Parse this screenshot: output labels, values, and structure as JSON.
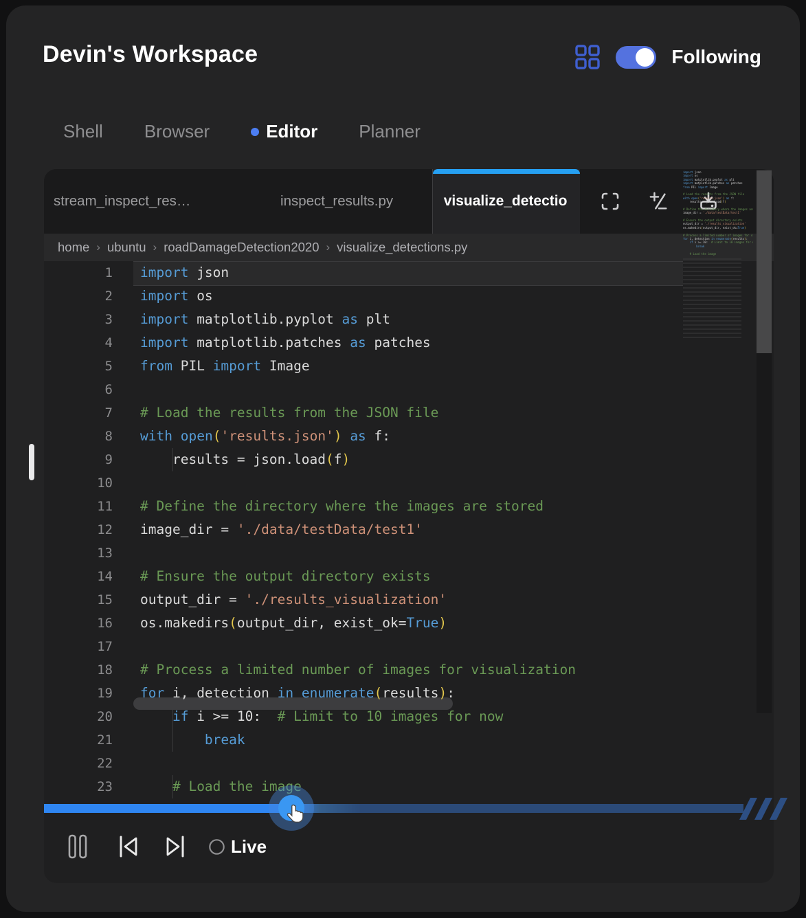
{
  "header": {
    "title": "Devin's Workspace",
    "toggle_label": "Following",
    "toggle_on": true
  },
  "nav_tabs": [
    {
      "label": "Shell",
      "active": false
    },
    {
      "label": "Browser",
      "active": false
    },
    {
      "label": "Editor",
      "active": true
    },
    {
      "label": "Planner",
      "active": false
    }
  ],
  "editor": {
    "file_tabs": [
      {
        "label": "stream_inspect_res…",
        "active": false
      },
      {
        "label": "inspect_results.py",
        "active": false
      },
      {
        "label": "visualize_detectio",
        "active": true
      }
    ],
    "breadcrumb": [
      "home",
      "ubuntu",
      "roadDamageDetection2020",
      "visualize_detections.py"
    ],
    "code_lines": [
      {
        "n": 1,
        "hl": true,
        "t": [
          [
            "k",
            "import"
          ],
          [
            "p",
            " json"
          ]
        ]
      },
      {
        "n": 2,
        "t": [
          [
            "k",
            "import"
          ],
          [
            "p",
            " os"
          ]
        ]
      },
      {
        "n": 3,
        "t": [
          [
            "k",
            "import"
          ],
          [
            "p",
            " matplotlib.pyplot "
          ],
          [
            "k",
            "as"
          ],
          [
            "p",
            " plt"
          ]
        ]
      },
      {
        "n": 4,
        "t": [
          [
            "k",
            "import"
          ],
          [
            "p",
            " matplotlib.patches "
          ],
          [
            "k",
            "as"
          ],
          [
            "p",
            " patches"
          ]
        ]
      },
      {
        "n": 5,
        "t": [
          [
            "k",
            "from"
          ],
          [
            "p",
            " PIL "
          ],
          [
            "k",
            "import"
          ],
          [
            "p",
            " Image"
          ]
        ]
      },
      {
        "n": 6,
        "t": []
      },
      {
        "n": 7,
        "t": [
          [
            "c",
            "# Load the results from the JSON file"
          ]
        ]
      },
      {
        "n": 8,
        "t": [
          [
            "k",
            "with"
          ],
          [
            "p",
            " "
          ],
          [
            "k",
            "open"
          ],
          [
            "y",
            "("
          ],
          [
            "s",
            "'results.json'"
          ],
          [
            "y",
            ")"
          ],
          [
            "p",
            " "
          ],
          [
            "k",
            "as"
          ],
          [
            "p",
            " f:"
          ]
        ]
      },
      {
        "n": 9,
        "g": [
          1
        ],
        "t": [
          [
            "p",
            "    results = json.load"
          ],
          [
            "y",
            "("
          ],
          [
            "p",
            "f"
          ],
          [
            "y",
            ")"
          ]
        ]
      },
      {
        "n": 10,
        "t": []
      },
      {
        "n": 11,
        "t": [
          [
            "c",
            "# Define the directory where the images are stored"
          ]
        ]
      },
      {
        "n": 12,
        "t": [
          [
            "p",
            "image_dir = "
          ],
          [
            "s",
            "'./data/testData/test1'"
          ]
        ]
      },
      {
        "n": 13,
        "t": []
      },
      {
        "n": 14,
        "t": [
          [
            "c",
            "# Ensure the output directory exists"
          ]
        ]
      },
      {
        "n": 15,
        "t": [
          [
            "p",
            "output_dir = "
          ],
          [
            "s",
            "'./results_visualization'"
          ]
        ]
      },
      {
        "n": 16,
        "t": [
          [
            "p",
            "os.makedirs"
          ],
          [
            "y",
            "("
          ],
          [
            "p",
            "output_dir, exist_ok="
          ],
          [
            "k",
            "True"
          ],
          [
            "y",
            ")"
          ]
        ]
      },
      {
        "n": 17,
        "t": []
      },
      {
        "n": 18,
        "t": [
          [
            "c",
            "# Process a limited number of images for visualization"
          ]
        ]
      },
      {
        "n": 19,
        "t": [
          [
            "k",
            "for"
          ],
          [
            "p",
            " i, detection "
          ],
          [
            "k",
            "in"
          ],
          [
            "p",
            " "
          ],
          [
            "k",
            "enumerate"
          ],
          [
            "y",
            "("
          ],
          [
            "p",
            "results"
          ],
          [
            "y",
            ")"
          ],
          [
            "p",
            ":"
          ]
        ]
      },
      {
        "n": 20,
        "g": [
          1
        ],
        "t": [
          [
            "p",
            "    "
          ],
          [
            "k",
            "if"
          ],
          [
            "p",
            " i >= 10:  "
          ],
          [
            "c",
            "# Limit to 10 images for now"
          ]
        ]
      },
      {
        "n": 21,
        "g": [
          1
        ],
        "t": [
          [
            "p",
            "        "
          ],
          [
            "k",
            "break"
          ]
        ]
      },
      {
        "n": 22,
        "t": []
      },
      {
        "n": 23,
        "g": [
          1
        ],
        "t": [
          [
            "p",
            "    "
          ],
          [
            "c",
            "# Load the image"
          ]
        ]
      }
    ]
  },
  "player": {
    "progress_pct": 35.4,
    "live_label": "Live"
  },
  "icons": {
    "header": [
      "grid-icon",
      "following-toggle"
    ],
    "editor_toolbar": [
      "fullscreen-icon",
      "font-size-icon",
      "download-icon",
      "kebab-icon"
    ],
    "player": [
      "pause-icon",
      "skip-back-icon",
      "skip-forward-icon",
      "live-radio"
    ]
  },
  "colors": {
    "accent_blue": "#2F86F2",
    "tab_active_bar": "#26A0F2",
    "toggle_blue": "#5472DF",
    "grid_icon_blue": "#3F5FD0",
    "editor_dot_blue": "#4C7EF3",
    "scrub_dark_blue": "#2B4A78",
    "keyword": "#569CD6",
    "string": "#CE9178",
    "comment": "#6A9955",
    "bracket": "#E2C64C"
  }
}
